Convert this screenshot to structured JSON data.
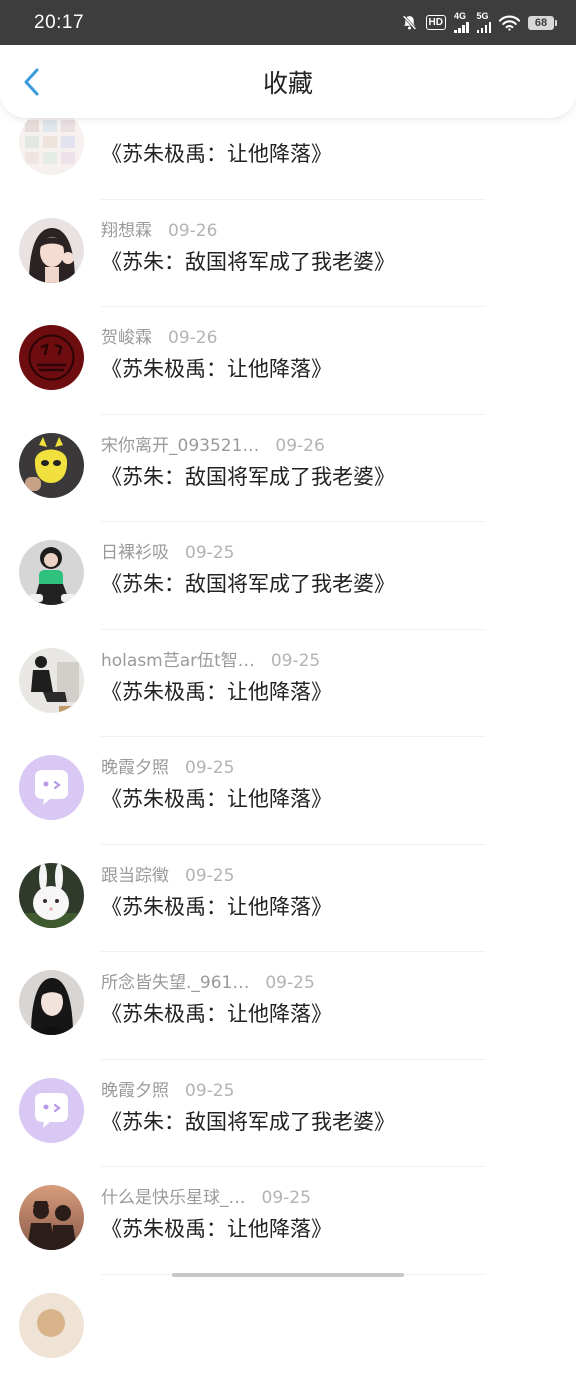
{
  "status": {
    "time": "20:17",
    "net1": "4G",
    "net2": "5G",
    "hd": "HD",
    "battery": "68"
  },
  "header": {
    "title": "收藏"
  },
  "items": [
    {
      "user": "",
      "date": "",
      "content": "《苏朱极禹：让他降落》",
      "avatar": "collage"
    },
    {
      "user": "翔想霖",
      "date": "09-26",
      "content": "《苏朱：敌国将军成了我老婆》",
      "avatar": "girl-dark-hair"
    },
    {
      "user": "贺峻霖",
      "date": "09-26",
      "content": "《苏朱极禹：让他降落》",
      "avatar": "red-badge"
    },
    {
      "user": "宋你离开_093521…",
      "date": "09-26",
      "content": "《苏朱：敌国将军成了我老婆》",
      "avatar": "yellow-mask"
    },
    {
      "user": "日裸衫吸",
      "date": "09-25",
      "content": "《苏朱：敌国将军成了我老婆》",
      "avatar": "person-headphones"
    },
    {
      "user": "holasm芑ar伍t智…",
      "date": "09-25",
      "content": "《苏朱极禹：让他降落》",
      "avatar": "person-sitting"
    },
    {
      "user": "晚霞夕照",
      "date": "09-25",
      "content": "《苏朱极禹：让他降落》",
      "avatar": "default-chat"
    },
    {
      "user": "跟当踪徵",
      "date": "09-25",
      "content": "《苏朱极禹：让他降落》",
      "avatar": "white-rabbit"
    },
    {
      "user": "所念皆失望._961…",
      "date": "09-25",
      "content": "《苏朱极禹：让他降落》",
      "avatar": "girl-black"
    },
    {
      "user": "晚霞夕照",
      "date": "09-25",
      "content": "《苏朱：敌国将军成了我老婆》",
      "avatar": "default-chat"
    },
    {
      "user": "什么是快乐星球_…",
      "date": "09-25",
      "content": "《苏朱极禹：让他降落》",
      "avatar": "couple-sunset"
    },
    {
      "user": "",
      "date": "",
      "content": "",
      "avatar": "partial"
    }
  ],
  "colors": {
    "accent": "#3a9bdc",
    "default_avatar_bg": "#d9c8f3"
  }
}
